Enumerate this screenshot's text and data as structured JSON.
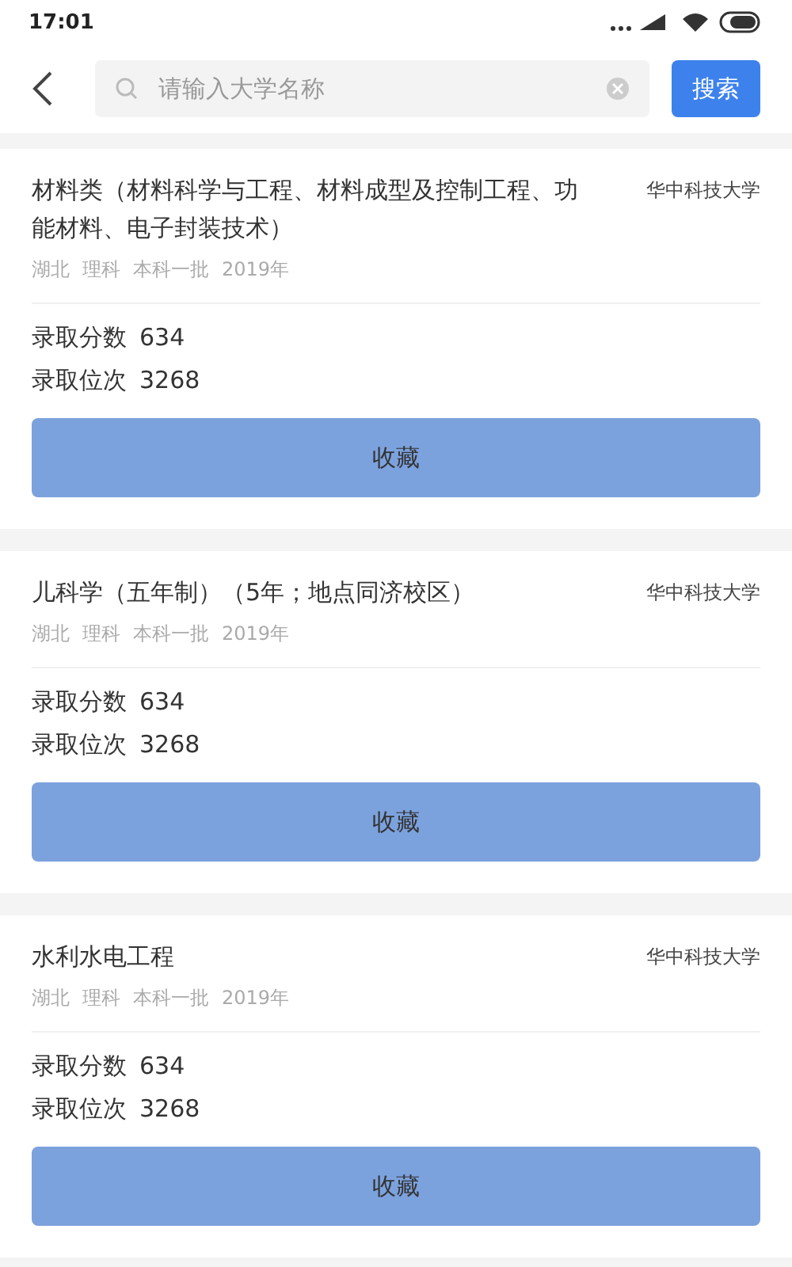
{
  "status_bar": {
    "time": "17:01"
  },
  "search": {
    "placeholder": "请输入大学名称",
    "button": "搜索"
  },
  "results": [
    {
      "major": "材料类（材料科学与工程、材料成型及控制工程、功能材料、电子封装技术）",
      "university": "华中科技大学",
      "meta": [
        "湖北",
        "理科",
        "本科一批",
        "2019年"
      ],
      "stats": [
        {
          "label": "录取分数",
          "value": "634"
        },
        {
          "label": "录取位次",
          "value": "3268"
        }
      ],
      "action": "收藏"
    },
    {
      "major": "儿科学（五年制）（5年；地点同济校区）",
      "university": "华中科技大学",
      "meta": [
        "湖北",
        "理科",
        "本科一批",
        "2019年"
      ],
      "stats": [
        {
          "label": "录取分数",
          "value": "634"
        },
        {
          "label": "录取位次",
          "value": "3268"
        }
      ],
      "action": "收藏"
    },
    {
      "major": "水利水电工程",
      "university": "华中科技大学",
      "meta": [
        "湖北",
        "理科",
        "本科一批",
        "2019年"
      ],
      "stats": [
        {
          "label": "录取分数",
          "value": "634"
        },
        {
          "label": "录取位次",
          "value": "3268"
        }
      ],
      "action": "收藏"
    }
  ]
}
